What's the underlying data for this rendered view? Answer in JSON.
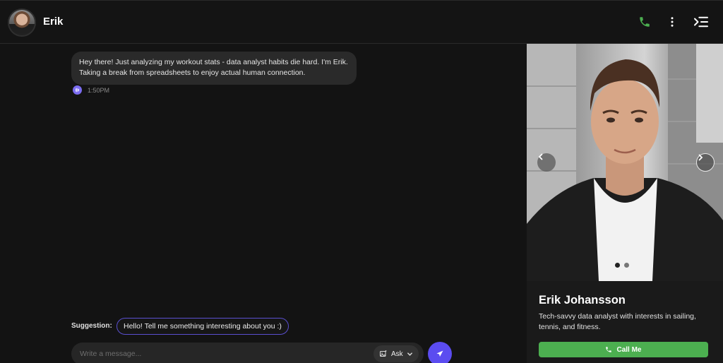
{
  "header": {
    "name": "Erik",
    "icons": [
      "phone-icon",
      "more-vertical-icon",
      "menu-collapse-icon"
    ]
  },
  "chat": {
    "message": {
      "text": "Hey there! Just analyzing my workout stats - data analyst habits die hard. I'm Erik. Taking a break from spreadsheets to enjoy actual human connection.",
      "time": "1:50PM"
    },
    "suggestion_label": "Suggestion:",
    "suggestion_text": "Hello! Tell me something interesting about you :)",
    "input_placeholder": "Write a message...",
    "ask_label": "Ask"
  },
  "profile": {
    "name": "Erik Johansson",
    "bio": "Tech-savvy data analyst with interests in sailing, tennis, and fitness.",
    "call_label": "Call Me",
    "carousel_active_index": 0,
    "carousel_count": 2
  },
  "colors": {
    "accent": "#5b4cf0",
    "call_green": "#4caf50",
    "phone_icon": "#4caf50"
  }
}
